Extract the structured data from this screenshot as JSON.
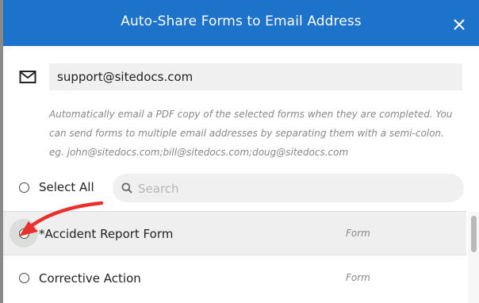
{
  "dialog": {
    "title": "Auto-Share Forms to Email Address",
    "close_icon": "close-icon"
  },
  "email": {
    "icon": "mail-icon",
    "value": "support@sitedocs.com"
  },
  "hint": {
    "line1": "Automatically email a PDF copy of the selected forms when they are completed. You",
    "line2": "can send forms to multiple email addresses by separating them with a semi-colon.",
    "line3": "eg. john@sitedocs.com;bill@sitedocs.com;doug@sitedocs.com"
  },
  "select_all": {
    "label": "Select All",
    "checked": false
  },
  "search": {
    "placeholder": "Search",
    "value": "",
    "icon": "search-icon"
  },
  "forms": [
    {
      "label": "*Accident Report Form",
      "type": "Form",
      "checked": false,
      "highlighted": true
    },
    {
      "label": "Corrective Action",
      "type": "Form",
      "checked": false,
      "highlighted": false
    }
  ],
  "colors": {
    "header": "#1d72c9",
    "annotation_arrow": "#e8302c"
  }
}
